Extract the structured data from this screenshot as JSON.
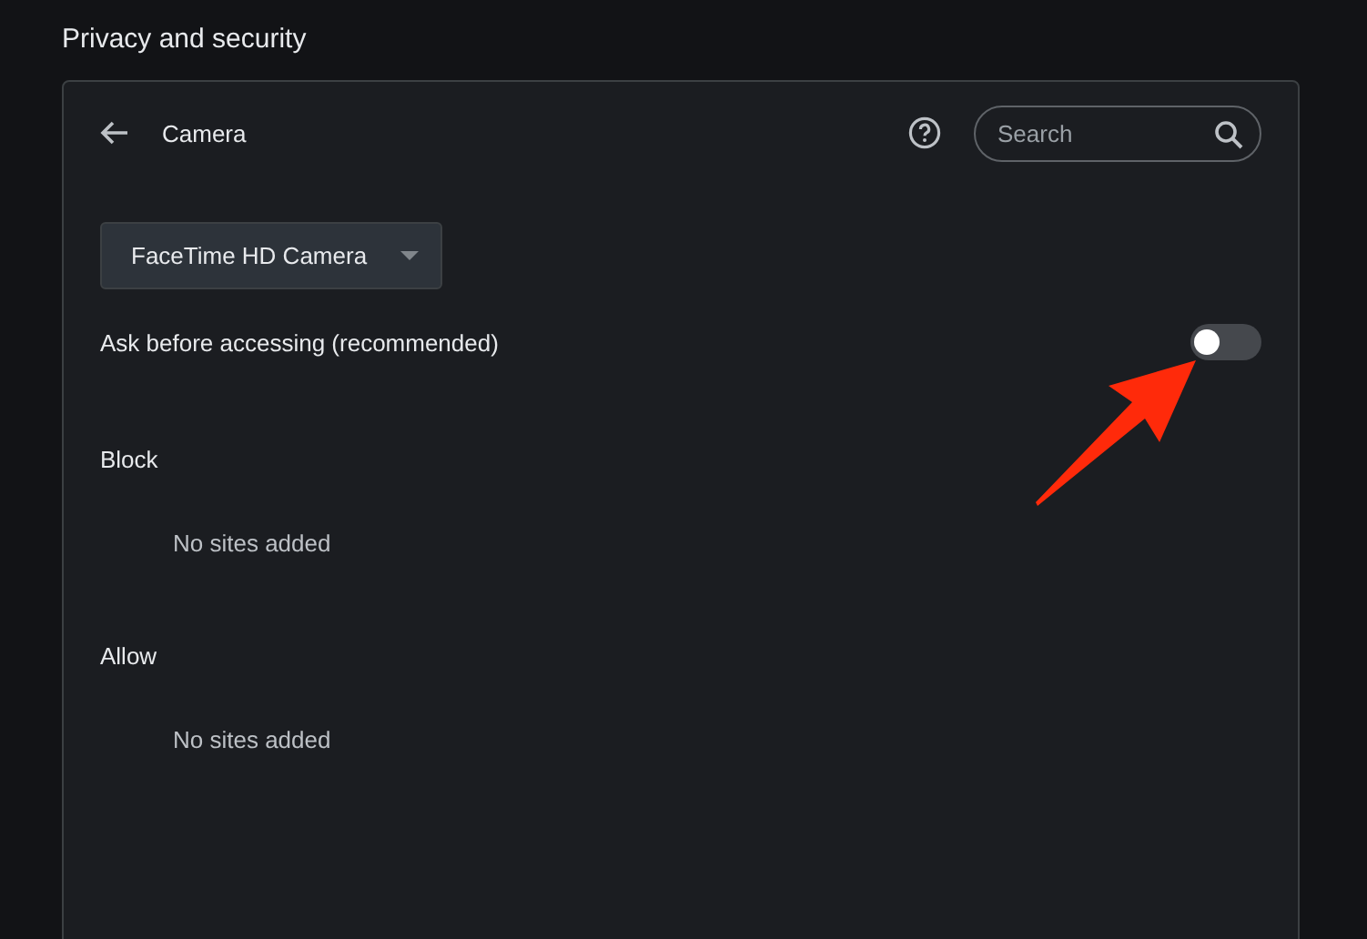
{
  "page_title": "Privacy and security",
  "header": {
    "title": "Camera",
    "search": {
      "placeholder": "Search"
    }
  },
  "device_select": {
    "value": "FaceTime HD Camera"
  },
  "ask_toggle": {
    "label": "Ask before accessing (recommended)",
    "on": false
  },
  "sections": [
    {
      "title": "Block",
      "empty_text": "No sites added"
    },
    {
      "title": "Allow",
      "empty_text": "No sites added"
    }
  ]
}
